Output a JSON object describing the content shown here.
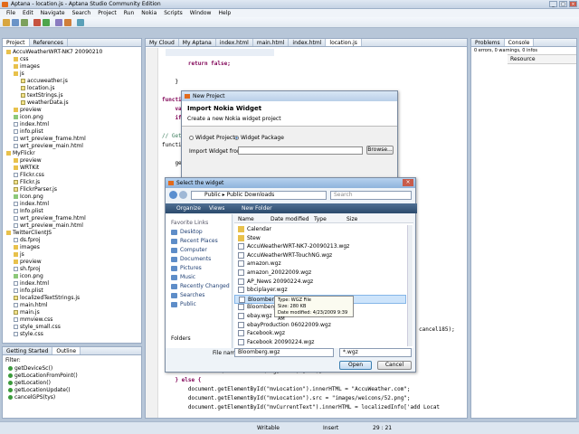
{
  "window": {
    "title": "Aptana - location.js - Aptana Studio Community Edition"
  },
  "menu": [
    "File",
    "Edit",
    "Navigate",
    "Search",
    "Project",
    "Run",
    "Nokia",
    "Scripts",
    "Window",
    "Help"
  ],
  "left_panel": {
    "tabs": [
      "Project",
      "References"
    ],
    "tree": [
      {
        "label": "AccuWeatherWRT-NK7 20090210",
        "level": 0,
        "icon": "folder"
      },
      {
        "label": "css",
        "level": 1,
        "icon": "folder"
      },
      {
        "label": "images",
        "level": 1,
        "icon": "folder"
      },
      {
        "label": "js",
        "level": 1,
        "icon": "folder"
      },
      {
        "label": "accuweather.js",
        "level": 2,
        "icon": "js"
      },
      {
        "label": "location.js",
        "level": 2,
        "icon": "js"
      },
      {
        "label": "textStrings.js",
        "level": 2,
        "icon": "js"
      },
      {
        "label": "weatherData.js",
        "level": 2,
        "icon": "js"
      },
      {
        "label": "preview",
        "level": 1,
        "icon": "folder"
      },
      {
        "label": "icon.png",
        "level": 1,
        "icon": "img"
      },
      {
        "label": "index.html",
        "level": 1,
        "icon": "file"
      },
      {
        "label": "info.plist",
        "level": 1,
        "icon": "file"
      },
      {
        "label": "wrt_preview_frame.html",
        "level": 1,
        "icon": "file"
      },
      {
        "label": "wrt_preview_main.html",
        "level": 1,
        "icon": "file"
      },
      {
        "label": "MyFlickr",
        "level": 0,
        "icon": "folder"
      },
      {
        "label": "preview",
        "level": 1,
        "icon": "folder"
      },
      {
        "label": "WRTKit",
        "level": 1,
        "icon": "folder"
      },
      {
        "label": "Flickr.css",
        "level": 1,
        "icon": "file"
      },
      {
        "label": "Flickr.js",
        "level": 1,
        "icon": "js"
      },
      {
        "label": "FlickrParser.js",
        "level": 1,
        "icon": "js"
      },
      {
        "label": "Icon.png",
        "level": 1,
        "icon": "img"
      },
      {
        "label": "index.html",
        "level": 1,
        "icon": "file"
      },
      {
        "label": "Info.plist",
        "level": 1,
        "icon": "file"
      },
      {
        "label": "wrt_preview_frame.html",
        "level": 1,
        "icon": "file"
      },
      {
        "label": "wrt_preview_main.html",
        "level": 1,
        "icon": "file"
      },
      {
        "label": "TwitterClientJS",
        "level": 0,
        "icon": "folder"
      },
      {
        "label": "ds.fproj",
        "level": 1,
        "icon": "file"
      },
      {
        "label": "images",
        "level": 1,
        "icon": "folder"
      },
      {
        "label": "js",
        "level": 1,
        "icon": "folder"
      },
      {
        "label": "preview",
        "level": 1,
        "icon": "folder"
      },
      {
        "label": "sh.fproj",
        "level": 1,
        "icon": "file"
      },
      {
        "label": "icon.png",
        "level": 1,
        "icon": "img"
      },
      {
        "label": "index.html",
        "level": 1,
        "icon": "file"
      },
      {
        "label": "info.plist",
        "level": 1,
        "icon": "file"
      },
      {
        "label": "localizedTextStrings.js",
        "level": 1,
        "icon": "js"
      },
      {
        "label": "main.html",
        "level": 1,
        "icon": "file"
      },
      {
        "label": "main.js",
        "level": 1,
        "icon": "js"
      },
      {
        "label": "mmview.css",
        "level": 1,
        "icon": "file"
      },
      {
        "label": "style_small.css",
        "level": 1,
        "icon": "file"
      },
      {
        "label": "style.css",
        "level": 1,
        "icon": "file"
      }
    ]
  },
  "outline_panel": {
    "tabs": [
      "Getting Started",
      "Outline"
    ],
    "filter_label": "Filter:",
    "items": [
      "getDeviceSc()",
      "getLocationFromPoint()",
      "getLocation()",
      "getLocationUpdate()",
      "cancelGPS(tys)"
    ]
  },
  "editor": {
    "tabs": [
      "My Cloud",
      "My Aptana",
      "index.html",
      "main.html",
      "index.html",
      "location.js"
    ],
    "active_tab": 5,
    "code": [
      {
        "text": "        return false;"
      },
      {
        "text": ""
      },
      {
        "text": "    }"
      },
      {
        "text": ""
      },
      {
        "text": "function getLocation() {"
      },
      {
        "text": "    var"
      },
      {
        "text": "    if"
      },
      {
        "text": ""
      },
      {
        "text": "// Get"
      },
      {
        "text": "functio"
      },
      {
        "text": ""
      },
      {
        "text": "    ge"
      },
      {
        "text": ""
      },
      {
        "text": "    }"
      },
      {
        "text": ""
      },
      {
        "text": ""
      },
      {
        "text": ""
      },
      {
        "text": ""
      },
      {
        "text": ""
      },
      {
        "text": ""
      },
      {
        "text": ""
      },
      {
        "text": ""
      },
      {
        "text": ""
      },
      {
        "text": ""
      },
      {
        "text": ""
      },
      {
        "text": ""
      },
      {
        "text": ""
      },
      {
        "text": ""
      },
      {
        "text": ""
      },
      {
        "text": ""
      },
      {
        "text": ""
      },
      {
        "text": ""
      },
      {
        "text": ""
      },
      {
        "text": ""
      },
      {
        "text": "        setTimeout('loadWeather(sig,units)',100);"
      },
      {
        "text": "    } else {"
      },
      {
        "text": "        document.getElementById(\"mvLocation\").innerHTML = \"AccuWeather.com\";"
      },
      {
        "text": "        document.getElementById(\"mvLocation\").src = \"images/weicons/52.png\";"
      },
      {
        "text": "        document.getElementById(\"mvCurrentText\").innerHTML = localizedInfo['add Locat"
      }
    ],
    "right_fragment": "cancel185);"
  },
  "right_panel": {
    "tabs": [
      "Problems",
      "Console"
    ],
    "summary": "0 errors, 0 warnings, 0 infos",
    "column": "Resource"
  },
  "nokia_dialog": {
    "title": "New Project",
    "header": "Import Nokia Widget",
    "subheader": "Create a new Nokia widget project",
    "radio_widget_project": "Widget Project",
    "radio_widget_package": "Widget Package",
    "import_label": "Import Widget from:",
    "browse_label": "Browse..."
  },
  "file_dialog": {
    "title": "Select the widget",
    "path": [
      "Public",
      "Public Downloads"
    ],
    "search_placeholder": "Search",
    "toolbar": [
      "Organize",
      "Views",
      "New Folder"
    ],
    "favorites_header": "Favorite Links",
    "favorites": [
      "Desktop",
      "Recent Places",
      "Computer",
      "Documents",
      "Pictures",
      "Music",
      "Recently Changed",
      "Searches",
      "Public"
    ],
    "folders_label": "Folders",
    "columns": [
      "Name",
      "Date modified",
      "Type",
      "Size"
    ],
    "files": [
      {
        "name": "Calendar",
        "kind": "folder"
      },
      {
        "name": "Stew",
        "kind": "folder"
      },
      {
        "name": "AccuWeatherWRT-NK7-20090213.wgz",
        "kind": "wgz"
      },
      {
        "name": "AccuWeatherWRT-TouchNG.wgz",
        "kind": "wgz"
      },
      {
        "name": "amazon.wgz",
        "kind": "wgz"
      },
      {
        "name": "amazon_20022009.wgz",
        "kind": "wgz"
      },
      {
        "name": "AP_News 20090224.wgz",
        "kind": "wgz"
      },
      {
        "name": "bbciplayer.wgz",
        "kind": "wgz"
      },
      {
        "name": "Bloomberg.wgz",
        "kind": "wgz",
        "selected": true
      },
      {
        "name": "Bloomberg-20",
        "kind": "wgz"
      },
      {
        "name": "ebay.wgz",
        "kind": "wgz"
      },
      {
        "name": "ebayProduction 06022009.wgz",
        "kind": "wgz"
      },
      {
        "name": "Facebook.wgz",
        "kind": "wgz"
      },
      {
        "name": "Facebook 20090224.wgz",
        "kind": "wgz"
      }
    ],
    "tooltip": [
      "Type: WGZ File",
      "Size: 280 KB",
      "Date modified: 4/23/2009 9:39 AM"
    ],
    "filename_label": "File name:",
    "filename_value": "Bloomberg.wgz",
    "filter_value": "*.wgz",
    "open_label": "Open",
    "cancel_label": "Cancel"
  },
  "status": {
    "mode": "Writable",
    "insert": "Insert",
    "position": "29 : 21"
  }
}
